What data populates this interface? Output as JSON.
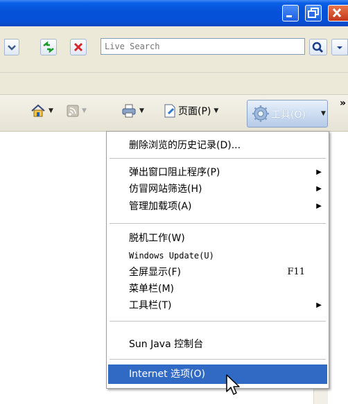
{
  "search": {
    "placeholder": "Live Search"
  },
  "command_bar": {
    "page_label": "页面(P)",
    "tools_label": "工具(O)",
    "overflow": "»"
  },
  "menu": {
    "items": [
      {
        "label": "删除浏览的历史记录(D)...",
        "submenu": false
      },
      {
        "label": "弹出窗口阻止程序(P)",
        "submenu": true
      },
      {
        "label": "仿冒网站筛选(H)",
        "submenu": true
      },
      {
        "label": "管理加载项(A)",
        "submenu": true
      },
      {
        "label": "脱机工作(W)",
        "submenu": false
      },
      {
        "label": "Windows Update(U)",
        "submenu": false
      },
      {
        "label": "全屏显示(F)",
        "submenu": false,
        "shortcut": "F11"
      },
      {
        "label": "菜单栏(M)",
        "submenu": false
      },
      {
        "label": "工具栏(T)",
        "submenu": true
      },
      {
        "label": "Sun Java 控制台",
        "submenu": false
      },
      {
        "label": "Internet 选项(O)",
        "submenu": false,
        "highlighted": true
      }
    ]
  },
  "colors": {
    "titlebar": "#0553d9",
    "menu_highlight": "#316ac5",
    "toolbar_bg": "#ece9d8"
  },
  "icons": [
    "minimize-icon",
    "restore-icon",
    "close-icon",
    "refresh-icon",
    "stop-icon",
    "search-icon",
    "home-icon",
    "feeds-icon",
    "print-icon",
    "page-icon",
    "gear-icon",
    "cursor-icon",
    "submenu-arrow-icon"
  ]
}
